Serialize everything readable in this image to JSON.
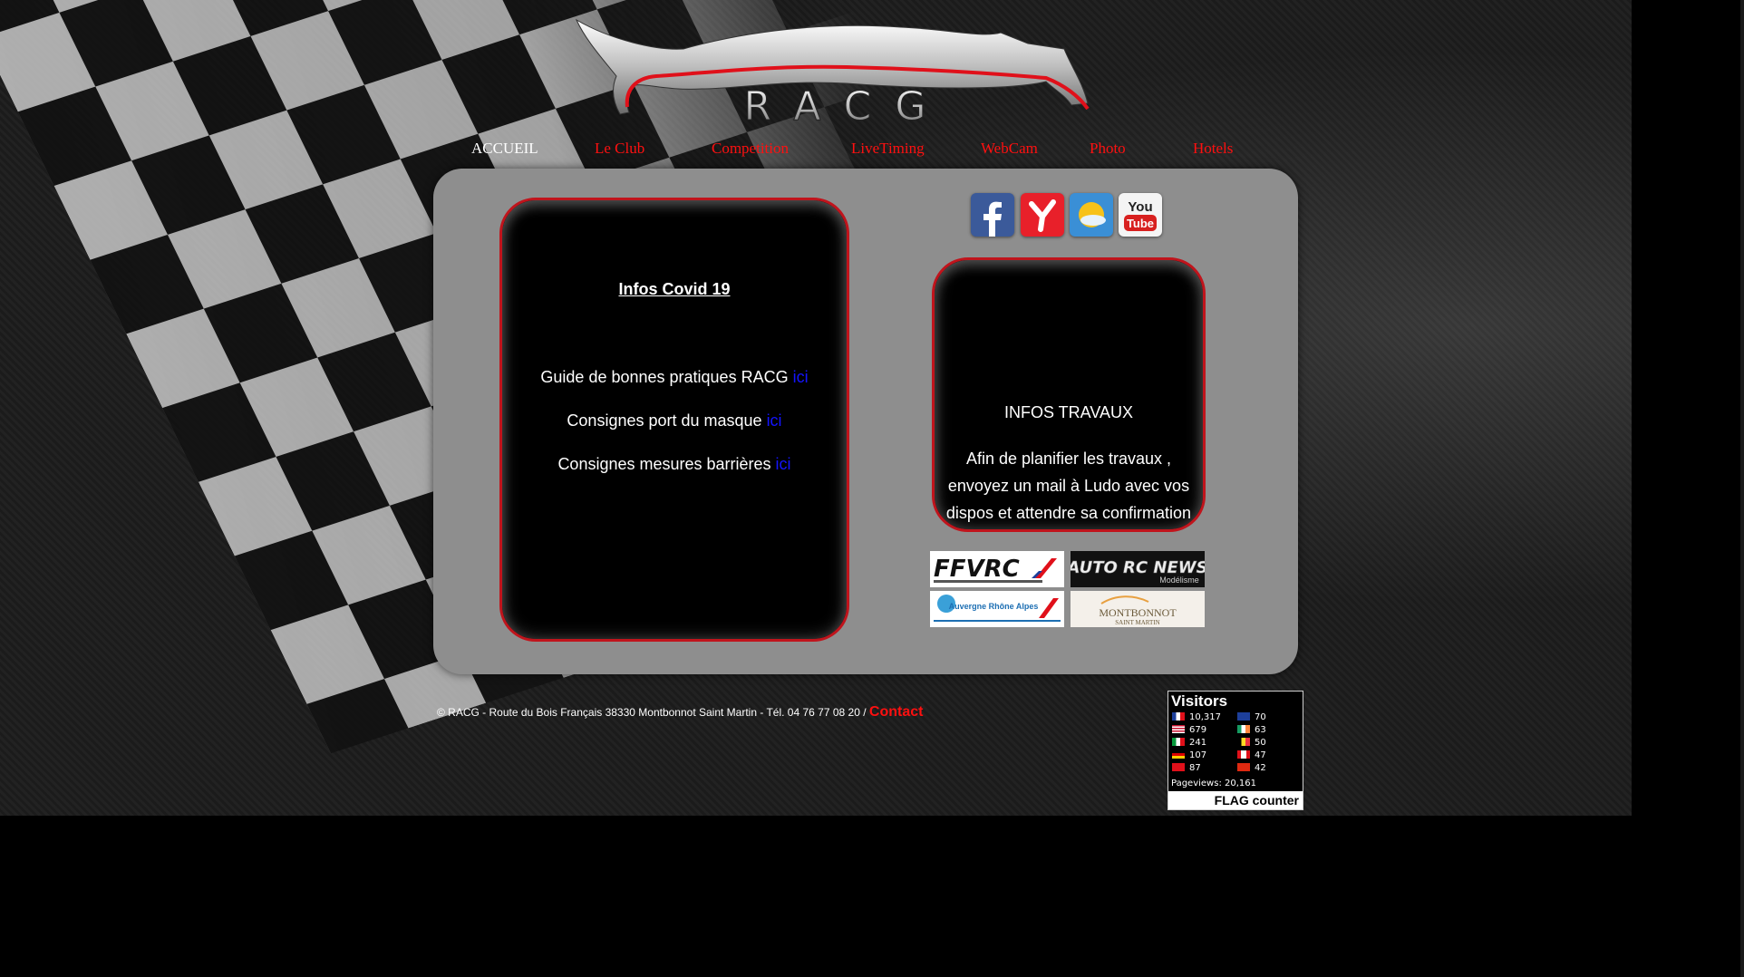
{
  "logo": {
    "text": "RACG"
  },
  "nav": {
    "items": [
      {
        "label": "ACCUEIL",
        "active": true
      },
      {
        "label": "Le Club"
      },
      {
        "label": "Competition"
      },
      {
        "label": "LiveTiming"
      },
      {
        "label": "WebCam"
      },
      {
        "label": "Photo"
      },
      {
        "label": "Hotels"
      }
    ]
  },
  "covid": {
    "title": "Infos Covid 19",
    "lines": [
      {
        "text": "Guide de bonnes pratiques RACG ",
        "link": "ici"
      },
      {
        "text": "Consignes port du masque ",
        "link": "ici"
      },
      {
        "text": "Consignes mesures barrières ",
        "link": "ici"
      }
    ]
  },
  "social": {
    "icons": [
      "facebook-icon",
      "yoopa-icon",
      "weather-icon",
      "youtube-icon"
    ],
    "youtube_top": "You",
    "youtube_bottom": "Tube"
  },
  "travaux": {
    "title": "INFOS TRAVAUX",
    "text": "Afin de planifier les travaux , envoyez un mail à Ludo avec vos dispos et attendre sa confirmation"
  },
  "partners": {
    "ffvrc": "FFVRC",
    "autorc": "AUTO RC NEWS",
    "autorc_sub": "Modélisme",
    "aura": "Auvergne Rhône Alpes",
    "montbonnot": "MONTBONNOT",
    "montbonnot_sub": "SAINT MARTIN"
  },
  "footer": {
    "text": "© RACG - Route du Bois Français 38330 Montbonnot Saint Martin - Tél. 04 76 77 08 20 / ",
    "contact": "Contact"
  },
  "flag_counter": {
    "title": "Visitors",
    "left": [
      {
        "flag": "fr",
        "count": "10,317"
      },
      {
        "flag": "us",
        "count": "679"
      },
      {
        "flag": "it",
        "count": "241"
      },
      {
        "flag": "de",
        "count": "107"
      },
      {
        "flag": "ch",
        "count": "87"
      }
    ],
    "right": [
      {
        "flag": "gb",
        "count": "70"
      },
      {
        "flag": "ie",
        "count": "63"
      },
      {
        "flag": "be",
        "count": "50"
      },
      {
        "flag": "ca",
        "count": "47"
      },
      {
        "flag": "cn",
        "count": "42"
      }
    ],
    "pageviews_label": "Pageviews:",
    "pageviews": "20,161",
    "brand": "FLAG counter"
  },
  "colors": {
    "accent_red": "#ff1010",
    "panel_gray": "#8e8e8e",
    "border_red": "#c0141c",
    "link_blue": "#1414ff"
  }
}
